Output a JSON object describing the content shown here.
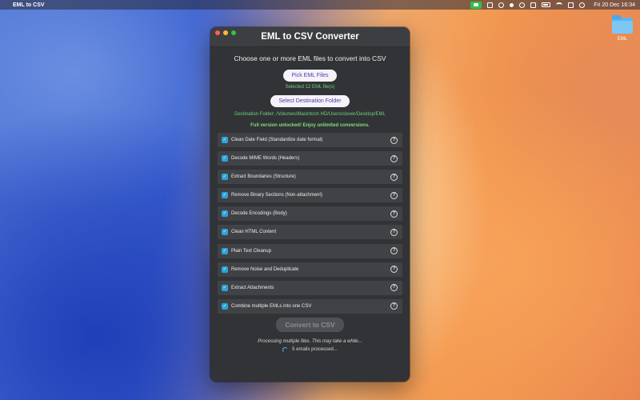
{
  "menubar": {
    "app_name": "EML to CSV",
    "clock": "Fri 20 Dec  16:34",
    "icons": [
      "apple-icon",
      "facetime-icon",
      "status-icon-1",
      "status-icon-2",
      "status-icon-3",
      "status-icon-4",
      "status-icon-5",
      "battery-icon",
      "wifi-icon",
      "control-center-icon",
      "siri-icon"
    ]
  },
  "desktop": {
    "folder_label": "EML"
  },
  "window": {
    "title": "EML to CSV Converter",
    "subtitle": "Choose one or more EML files to convert into CSV",
    "pick_button": "Pick EML Files",
    "selected_text": "Selected 12 EML file(s)",
    "dest_button": "Select Destination Folder",
    "dest_text": "Destination Folder: /Volumes/Macintosh HD/Users/clever/Desktop/EML",
    "unlock_text": "Full version unlocked! Enjoy unlimited conversions.",
    "options": [
      {
        "label": "Clean Date Field (Standardize date format)",
        "checked": true
      },
      {
        "label": "Decode MIME Words (Headers)",
        "checked": true
      },
      {
        "label": "Extract Boundaries (Structure)",
        "checked": true
      },
      {
        "label": "Remove Binary Sections (Non-attachment)",
        "checked": true
      },
      {
        "label": "Decode Encodings (Body)",
        "checked": true
      },
      {
        "label": "Clean HTML Content",
        "checked": true
      },
      {
        "label": "Plain Text Cleanup",
        "checked": true
      },
      {
        "label": "Remove Noise and Deduplicate",
        "checked": true
      },
      {
        "label": "Extract Attachments",
        "checked": true
      },
      {
        "label": "Combine multiple EMLs into one CSV",
        "checked": true
      }
    ],
    "check_glyph": "✓",
    "help_glyph": "?",
    "convert_button": "Convert to CSV",
    "processing_text": "Processing multiple files. This may take a while...",
    "status_text": "5 emails processed..."
  },
  "colors": {
    "accent": "#2aa4d8",
    "success_text": "#6fd37a",
    "button_text": "#5e35b1",
    "window_bg": "#323336"
  }
}
